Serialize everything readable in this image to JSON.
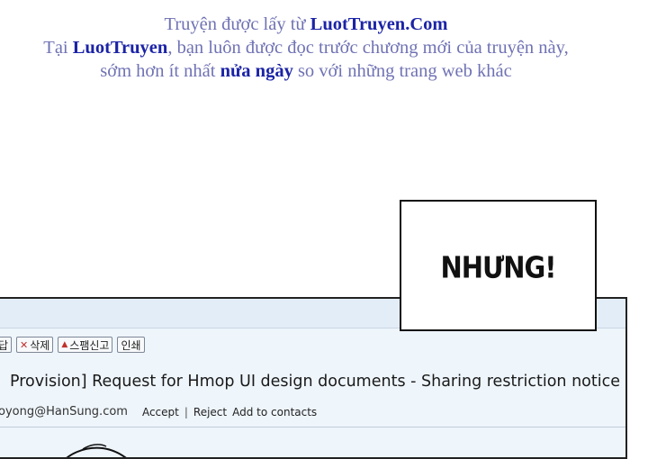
{
  "watermark": {
    "line1_prefix": "Truyện được lấy từ ",
    "line1_site": "LuotTruyen.Com",
    "line2_prefix": "Tại ",
    "line2_site": "LuotTruyen",
    "line2_suffix": ", bạn luôn được đọc trước chương mới của truyện này,",
    "line3_prefix": "sớm hơn ít nhất ",
    "line3_emph": "nửa ngày",
    "line3_suffix": " so với những trang web khác"
  },
  "speech": {
    "text": "NHƯNG!"
  },
  "mail": {
    "toolbar": {
      "reply_label": "답",
      "delete_label": "삭제",
      "spam_label": "스팸신고",
      "print_label": "인쇄"
    },
    "subject": "Provision] Request for Hmop UI design documents - Sharing restriction notice",
    "sender_email": "oyong@HanSung.com",
    "accept_label": "Accept",
    "separator": "|",
    "reject_label": "Reject",
    "add_contacts_label": "Add to contacts"
  },
  "icons": {
    "delete": "close-icon",
    "spam": "triangle-icon"
  },
  "colors": {
    "watermark_text": "#6f72b4",
    "watermark_emphasis": "#1b23a6",
    "mail_background": "#eef5fb",
    "delete_icon": "#c0302c"
  }
}
